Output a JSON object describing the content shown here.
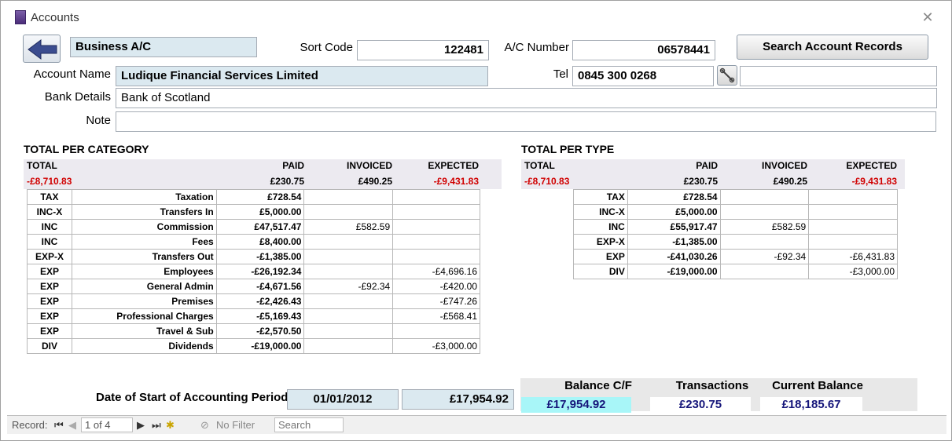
{
  "window": {
    "title": "Accounts"
  },
  "account": {
    "type": "Business A/C",
    "sort_code_label": "Sort Code",
    "sort_code": "122481",
    "ac_number_label": "A/C Number",
    "ac_number": "06578441",
    "search_label": "Search Account Records",
    "name_label": "Account Name",
    "name": "Ludique Financial Services Limited",
    "tel_label": "Tel",
    "tel": "0845 300 0268",
    "tel_extra": "",
    "bank_label": "Bank Details",
    "bank": "Bank of Scotland",
    "note_label": "Note",
    "note": ""
  },
  "category": {
    "title": "TOTAL PER CATEGORY",
    "headers": {
      "total": "TOTAL",
      "paid": "PAID",
      "invoiced": "INVOICED",
      "expected": "EXPECTED"
    },
    "totals": {
      "total": "-£8,710.83",
      "paid": "£230.75",
      "invoiced": "£490.25",
      "expected": "-£9,431.83"
    },
    "rows": [
      {
        "code": "TAX",
        "name": "Taxation",
        "paid": "£728.54",
        "invoiced": "",
        "expected": ""
      },
      {
        "code": "INC-X",
        "name": "Transfers In",
        "paid": "£5,000.00",
        "invoiced": "",
        "expected": ""
      },
      {
        "code": "INC",
        "name": "Commission",
        "paid": "£47,517.47",
        "invoiced": "£582.59",
        "expected": ""
      },
      {
        "code": "INC",
        "name": "Fees",
        "paid": "£8,400.00",
        "invoiced": "",
        "expected": ""
      },
      {
        "code": "EXP-X",
        "name": "Transfers Out",
        "paid": "-£1,385.00",
        "invoiced": "",
        "expected": ""
      },
      {
        "code": "EXP",
        "name": "Employees",
        "paid": "-£26,192.34",
        "invoiced": "",
        "expected": "-£4,696.16"
      },
      {
        "code": "EXP",
        "name": "General Admin",
        "paid": "-£4,671.56",
        "invoiced": "-£92.34",
        "expected": "-£420.00"
      },
      {
        "code": "EXP",
        "name": "Premises",
        "paid": "-£2,426.43",
        "invoiced": "",
        "expected": "-£747.26"
      },
      {
        "code": "EXP",
        "name": "Professional Charges",
        "paid": "-£5,169.43",
        "invoiced": "",
        "expected": "-£568.41"
      },
      {
        "code": "EXP",
        "name": "Travel & Sub",
        "paid": "-£2,570.50",
        "invoiced": "",
        "expected": ""
      },
      {
        "code": "DIV",
        "name": "Dividends",
        "paid": "-£19,000.00",
        "invoiced": "",
        "expected": "-£3,000.00"
      }
    ]
  },
  "type": {
    "title": "TOTAL PER TYPE",
    "headers": {
      "total": "TOTAL",
      "paid": "PAID",
      "invoiced": "INVOICED",
      "expected": "EXPECTED"
    },
    "totals": {
      "total": "-£8,710.83",
      "paid": "£230.75",
      "invoiced": "£490.25",
      "expected": "-£9,431.83"
    },
    "rows": [
      {
        "code": "TAX",
        "paid": "£728.54",
        "invoiced": "",
        "expected": ""
      },
      {
        "code": "INC-X",
        "paid": "£5,000.00",
        "invoiced": "",
        "expected": ""
      },
      {
        "code": "INC",
        "paid": "£55,917.47",
        "invoiced": "£582.59",
        "expected": ""
      },
      {
        "code": "EXP-X",
        "paid": "-£1,385.00",
        "invoiced": "",
        "expected": ""
      },
      {
        "code": "EXP",
        "paid": "-£41,030.26",
        "invoiced": "-£92.34",
        "expected": "-£6,431.83"
      },
      {
        "code": "DIV",
        "paid": "-£19,000.00",
        "invoiced": "",
        "expected": "-£3,000.00"
      }
    ]
  },
  "period": {
    "label": "Date of Start of Accounting Period",
    "date": "01/01/2012",
    "amount": "£17,954.92"
  },
  "balance": {
    "bf_label": "Balance C/F",
    "bf_value": "£17,954.92",
    "tx_label": "Transactions",
    "tx_value": "£230.75",
    "current_label": "Current Balance",
    "current_value": "£18,185.67"
  },
  "statusbar": {
    "record_label": "Record:",
    "record_value": "1 of 4",
    "filter_label": "No Filter",
    "search_placeholder": "Search"
  },
  "colors": {
    "negative": "#d00000",
    "balance_text": "#15157a",
    "highlight": "#a8f6f8"
  }
}
